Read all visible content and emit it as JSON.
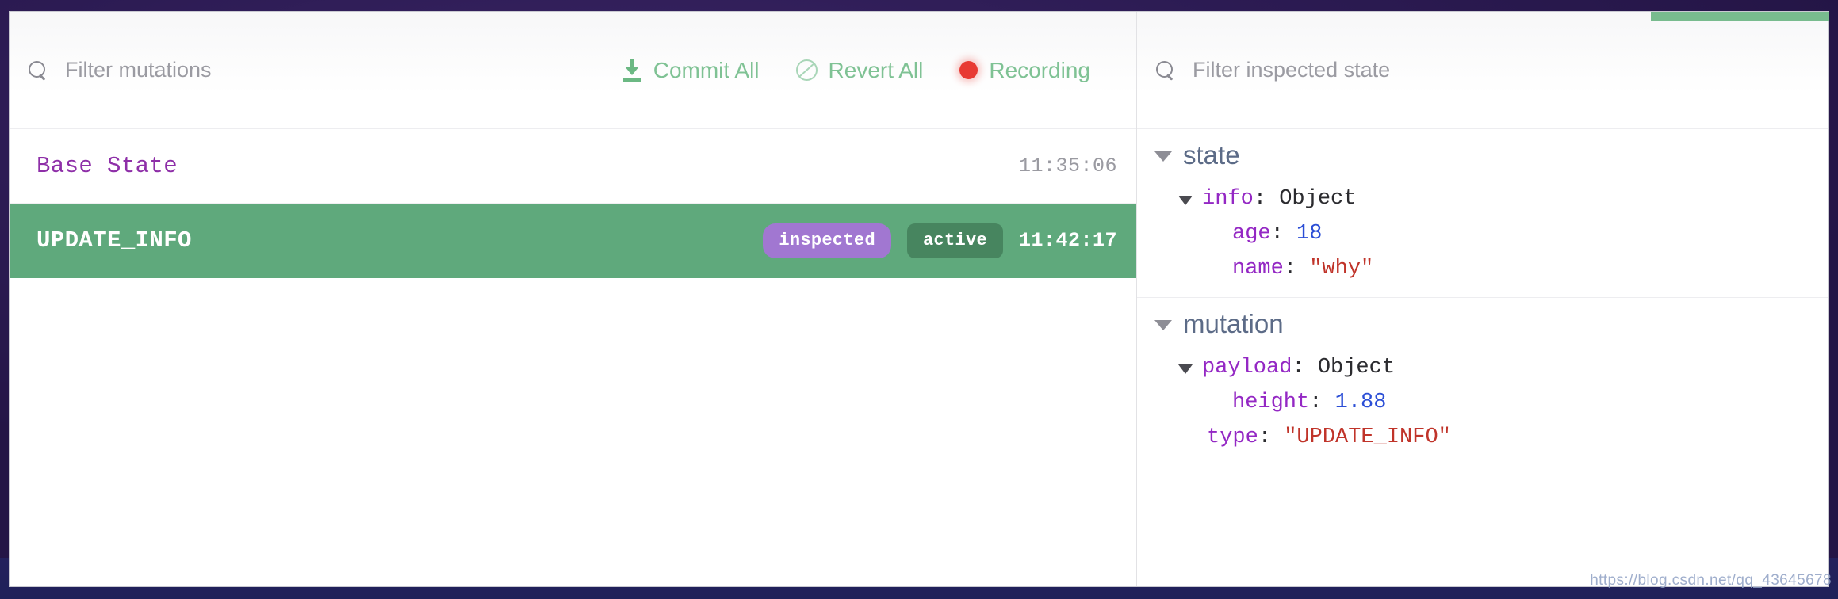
{
  "window": {
    "accent_color": "#78bb8e",
    "backdrop_color": "#2d1c56"
  },
  "mutations_pane": {
    "search": {
      "icon": "search-icon",
      "placeholder": "Filter mutations",
      "value": ""
    },
    "actions": [
      {
        "id": "commit-all",
        "icon": "download-icon",
        "label": "Commit All",
        "color": "#7fc294"
      },
      {
        "id": "revert-all",
        "icon": "ban-icon",
        "label": "Revert All",
        "color": "#7fc294"
      },
      {
        "id": "recording",
        "icon": "record-dot-icon",
        "label": "Recording",
        "color": "#7fc294",
        "dot_color": "#e83a33"
      }
    ],
    "rows": [
      {
        "name": "Base State",
        "time": "11:35:06",
        "selected": false,
        "badges": []
      },
      {
        "name": "UPDATE_INFO",
        "time": "11:42:17",
        "selected": true,
        "badges": [
          {
            "label": "inspected",
            "color": "#a177d1"
          },
          {
            "label": "active",
            "color": "#47855f"
          }
        ]
      }
    ]
  },
  "inspector_pane": {
    "search": {
      "icon": "search-icon",
      "placeholder": "Filter inspected state",
      "value": ""
    },
    "sections": [
      {
        "id": "state",
        "title": "state",
        "highlighted": true,
        "highlight_color": "#ef3b33",
        "lines": [
          {
            "indent": 1,
            "caret": true,
            "key": "info",
            "sep": ": ",
            "value": "Object",
            "value_type": "plain"
          },
          {
            "indent": 2,
            "caret": false,
            "key": "age",
            "sep": ": ",
            "value": "18",
            "value_type": "number"
          },
          {
            "indent": 2,
            "caret": false,
            "key": "name",
            "sep": ": ",
            "value": "\"why\"",
            "value_type": "string"
          }
        ]
      },
      {
        "id": "mutation",
        "title": "mutation",
        "highlighted": false,
        "lines": [
          {
            "indent": 1,
            "caret": true,
            "key": "payload",
            "sep": ": ",
            "value": "Object",
            "value_type": "plain"
          },
          {
            "indent": 2,
            "caret": false,
            "key": "height",
            "sep": ": ",
            "value": "1.88",
            "value_type": "number"
          },
          {
            "indent": 1.5,
            "caret": false,
            "key": "type",
            "sep": ": ",
            "value": "\"UPDATE_INFO\"",
            "value_type": "string"
          }
        ]
      }
    ]
  },
  "watermark": "https://blog.csdn.net/qq_43645678"
}
